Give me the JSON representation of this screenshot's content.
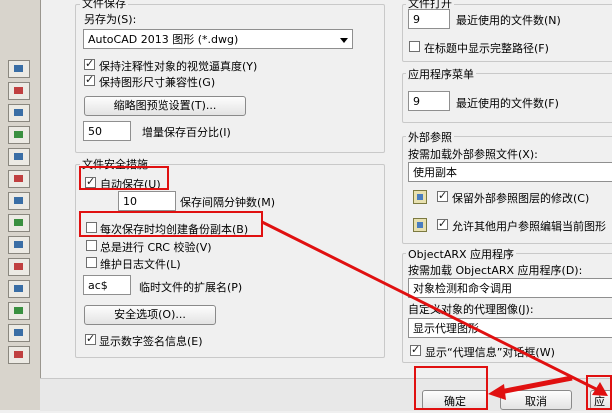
{
  "left": {
    "save_group_title": "文件保存",
    "save_as_label": "另存为(S):",
    "save_as_value": "AutoCAD 2013 图形 (*.dwg)",
    "keep_visual_fidelity": "保持注释性对象的视觉逼真度(Y)",
    "keep_size_compat": "保持图形尺寸兼容性(G)",
    "thumbnail_button": "缩略图预览设置(T)...",
    "incremental_value": "50",
    "incremental_label": "增量保存百分比(I)",
    "safety_group_title": "文件安全措施",
    "autosave_label": "自动保存(U)",
    "autosave_minutes": "10",
    "autosave_minutes_label": "保存间隔分钟数(M)",
    "backup_label": "每次保存时均创建备份副本(B)",
    "crc_label": "总是进行 CRC 校验(V)",
    "log_label": "维护日志文件(L)",
    "ext_value": "ac$",
    "ext_label": "临时文件的扩展名(P)",
    "security_button": "安全选项(O)...",
    "digital_sig_label": "显示数字签名信息(E)"
  },
  "right": {
    "file_open_title": "文件打开",
    "recent_files_value": "9",
    "recent_files_label": "最近使用的文件数(N)",
    "full_path_label": "在标题中显示完整路径(F)",
    "app_menu_title": "应用程序菜单",
    "app_recent_value": "9",
    "app_recent_label": "最近使用的文件数(F)",
    "xref_title": "外部参照",
    "xref_load_label": "按需加载外部参照文件(X):",
    "xref_load_value": "使用副本",
    "xref_keep_label": "保留外部参照图层的修改(C)",
    "xref_allow_label": "允许其他用户参照编辑当前图形",
    "arx_title": "ObjectARX 应用程序",
    "arx_load_label": "按需加载 ObjectARX 应用程序(D):",
    "arx_load_value": "对象检测和命令调用",
    "proxy_label": "自定义对象的代理图像(J):",
    "proxy_value": "显示代理图形",
    "proxy_info_label": "显示“代理信息”对话框(W)"
  },
  "footer": {
    "ok_label": "确定",
    "cancel_label": "取消",
    "apply_label": "应"
  },
  "states": {
    "keep_visual_fidelity": true,
    "keep_size_compat": true,
    "autosave": true,
    "backup": false,
    "crc": false,
    "log": false,
    "digital_sig": true,
    "full_path": false,
    "xref_keep": true,
    "xref_allow": true,
    "proxy_info": true
  },
  "colors": {
    "highlight": "#e01010",
    "arrow": "#e01010"
  }
}
